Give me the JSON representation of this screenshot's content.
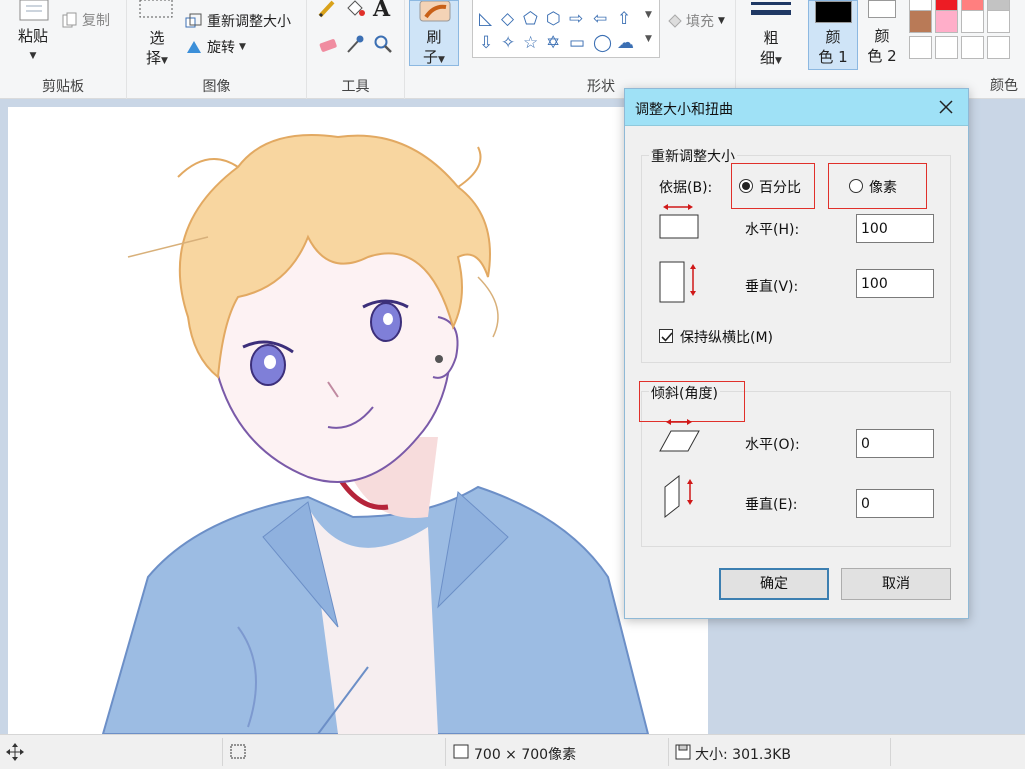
{
  "ribbon": {
    "clipboard": {
      "paste": "粘贴",
      "copy": "复制",
      "label": "剪贴板"
    },
    "image": {
      "select": "选",
      "select2": "择",
      "resize": "重新调整大小",
      "rotate": "旋转",
      "label": "图像"
    },
    "tools": {
      "label": "工具"
    },
    "brush": {
      "line1": "刷",
      "line2": "子"
    },
    "shapes": {
      "fill": "填充",
      "label": "形状"
    },
    "size": {
      "line1": "粗",
      "line2": "细"
    },
    "color1": {
      "line1": "颜",
      "line2": "色 1"
    },
    "color2": {
      "line1": "颜",
      "line2": "色 2"
    },
    "colors": {
      "label": "颜色"
    },
    "palette": [
      "#ffffff",
      "#ed1c24",
      "#ff7f7f",
      "#c3c3c3",
      "#b97a57",
      "#ffaec9",
      "#ffffff",
      "#ffffff",
      "#ffffff",
      "#ffffff",
      "#ffffff",
      "#ffffff"
    ]
  },
  "statusbar": {
    "dimensions": "700 × 700像素",
    "size": "大小: 301.3KB"
  },
  "dialog": {
    "title": "调整大小和扭曲",
    "resize": {
      "legend": "重新调整大小",
      "by_label": "依据(B):",
      "percent": "百分比",
      "pixels": "像素",
      "horizontal_label": "水平(H):",
      "horizontal_value": "100",
      "vertical_label": "垂直(V):",
      "vertical_value": "100",
      "keep_ratio": "保持纵横比(M)"
    },
    "skew": {
      "legend": "倾斜(角度)",
      "horizontal_label": "水平(O):",
      "horizontal_value": "0",
      "vertical_label": "垂直(E):",
      "vertical_value": "0"
    },
    "ok": "确定",
    "cancel": "取消"
  }
}
